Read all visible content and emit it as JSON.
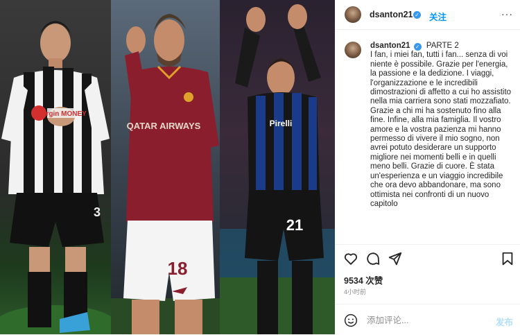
{
  "header": {
    "username": "dsanton21",
    "follow_label": "关注",
    "more_label": "···"
  },
  "caption": {
    "username": "dsanton21",
    "title": "PARTE 2",
    "body": "I fan, i miei fan, tutti i fan... senza di voi niente è possibile. Grazie per l'energia, la passione e la dedizione. I viaggi, l'organizzazione e le incredibili dimostrazioni di affetto a cui ho assistito nella mia carriera sono stati mozzafiato. Grazie a chi mi ha sostenuto fino alla fine. Infine, alla mia famiglia. Il vostro amore e la vostra pazienza mi hanno permesso di vivere il mio sogno, non avrei potuto desiderare un supporto migliore nei momenti belli e in quelli meno belli. Grazie di cuore. È stata un'esperienza e un viaggio incredibile che ora devo abbandonare, ma sono ottimista nei confronti di un nuovo capitolo"
  },
  "photo": {
    "panels": [
      {
        "jersey_number": "3",
        "sponsor": "Virgin MONEY"
      },
      {
        "jersey_number": "18",
        "sponsor": "QATAR AIRWAYS"
      },
      {
        "jersey_number": "21",
        "sponsor": "Pirelli"
      }
    ]
  },
  "stats": {
    "likes": "9534 次赞",
    "time_ago": "4小时前"
  },
  "composer": {
    "placeholder": "添加评论...",
    "post_label": "发布"
  },
  "icons": [
    "like-heart-icon",
    "comment-icon",
    "share-icon",
    "bookmark-icon",
    "emoji-icon",
    "more-options-icon",
    "verified-badge-icon"
  ],
  "colors": {
    "accent": "#0095f6",
    "verified": "#3897f0",
    "post_disabled": "#b2dffc",
    "newcastle_stripes": [
      "#111111",
      "#ffffff"
    ],
    "roma_kit": "#8b1e2d",
    "inter_kit": "#1a3a8a"
  }
}
